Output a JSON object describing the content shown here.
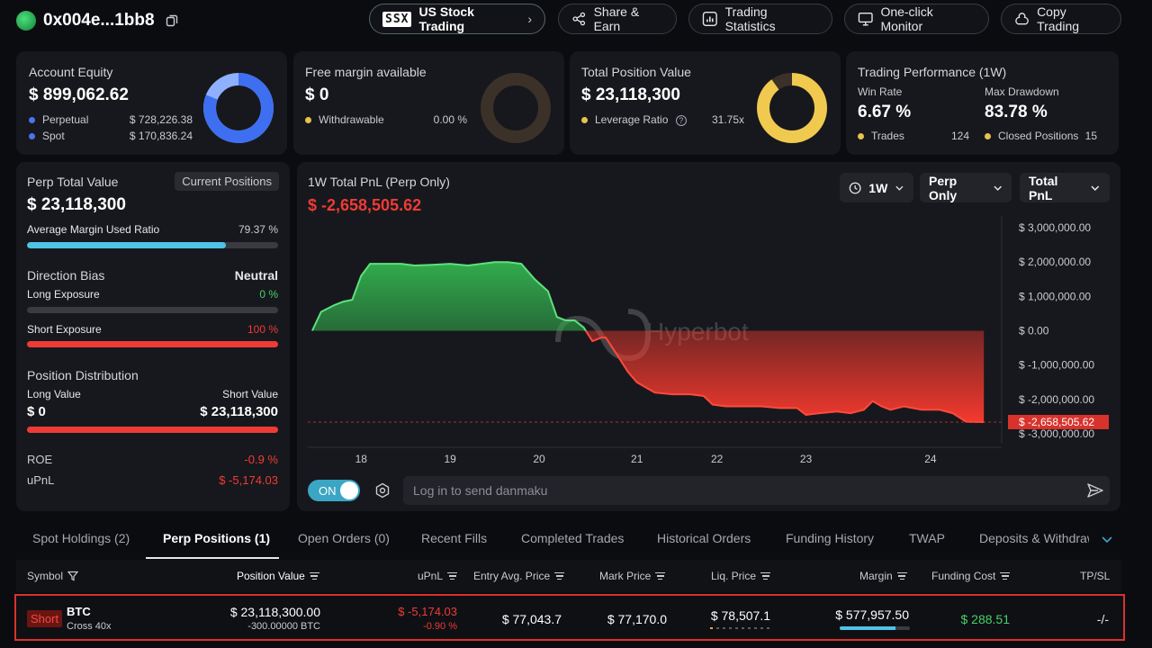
{
  "header": {
    "address": "0x004e...1bb8",
    "nav": [
      "US Stock Trading",
      "Share & Earn",
      "Trading Statistics",
      "One-click Monitor",
      "Copy Trading"
    ],
    "us_stock_logo": "SSX"
  },
  "equity": {
    "title": "Account Equity",
    "value": "$ 899,062.62",
    "rows": [
      {
        "label": "Perpetual",
        "value": "$ 728,226.38"
      },
      {
        "label": "Spot",
        "value": "$ 170,836.24"
      }
    ],
    "perp_share": 0.81,
    "color_perp": "#3e6ff0",
    "color_spot": "#8fb0ff"
  },
  "margin": {
    "title": "Free margin available",
    "value": "$ 0",
    "row_label": "Withdrawable",
    "row_value": "0.00 %"
  },
  "position_value": {
    "title": "Total Position Value",
    "value": "$ 23,118,300",
    "row_label": "Leverage Ratio",
    "row_value": "31.75x",
    "gauge_fill": 0.9
  },
  "performance": {
    "title": "Trading Performance (1W)",
    "win_rate_label": "Win Rate",
    "win_rate": "6.67 %",
    "drawdown_label": "Max Drawdown",
    "drawdown": "83.78 %",
    "trades_label": "Trades",
    "trades": "124",
    "closed_label": "Closed Positions",
    "closed": "15"
  },
  "perp_panel": {
    "title": "Perp Total Value",
    "tag": "Current Positions",
    "value": "$ 23,118,300",
    "margin_ratio_label": "Average Margin Used Ratio",
    "margin_ratio": "79.37 %",
    "margin_ratio_value": 0.7937,
    "bias_label": "Direction Bias",
    "bias": "Neutral",
    "long_exp_label": "Long Exposure",
    "long_exp": "0 %",
    "short_exp_label": "Short Exposure",
    "short_exp": "100 %",
    "dist_label": "Position Distribution",
    "long_value_label": "Long Value",
    "short_value_label": "Short Value",
    "long_value": "$ 0",
    "short_value": "$ 23,118,300",
    "roe_label": "ROE",
    "roe": "-0.9 %",
    "upnl_label": "uPnL",
    "upnl": "$ -5,174.03"
  },
  "pnl": {
    "title": "1W Total PnL (Perp Only)",
    "value": "$ -2,658,505.62",
    "dropdowns": [
      "1W",
      "Perp Only",
      "Total PnL"
    ],
    "watermark": "Hyperbot",
    "toggle": "ON",
    "danmaku_placeholder": "Log in to send danmaku"
  },
  "chart_data": {
    "type": "area",
    "y_ticks": [
      "$ 3,000,000.00",
      "$ 2,000,000.00",
      "$ 1,000,000.00",
      "$ 0.00",
      "$ -1,000,000.00",
      "$ -2,000,000.00",
      "$ -3,000,000.00"
    ],
    "ylim": [
      -3000000,
      3000000
    ],
    "x_ticks": [
      {
        "label": "18",
        "x": 18.0
      },
      {
        "label": "19",
        "x": 19.0
      },
      {
        "label": "20",
        "x": 20.0
      },
      {
        "label": "21",
        "x": 21.1
      },
      {
        "label": "22",
        "x": 22.0
      },
      {
        "label": "23",
        "x": 23.0
      },
      {
        "label": "24",
        "x": 24.4
      }
    ],
    "xlim": [
      17.4,
      25.2
    ],
    "current_label": "$ -2,658,505.62",
    "current_value": -2658505.62,
    "points": [
      [
        17.45,
        0.0
      ],
      [
        17.55,
        550000
      ],
      [
        17.7,
        750000
      ],
      [
        17.8,
        850000
      ],
      [
        17.9,
        900000
      ],
      [
        18.0,
        1600000
      ],
      [
        18.1,
        1950000
      ],
      [
        18.25,
        1950000
      ],
      [
        18.45,
        1950000
      ],
      [
        18.6,
        1900000
      ],
      [
        18.8,
        1920000
      ],
      [
        19.0,
        1950000
      ],
      [
        19.2,
        1900000
      ],
      [
        19.35,
        1950000
      ],
      [
        19.5,
        2000000
      ],
      [
        19.65,
        2000000
      ],
      [
        19.8,
        1950000
      ],
      [
        19.95,
        1500000
      ],
      [
        20.1,
        1150000
      ],
      [
        20.2,
        400000
      ],
      [
        20.3,
        300000
      ],
      [
        20.4,
        300000
      ],
      [
        20.5,
        100000
      ],
      [
        20.6,
        -300000
      ],
      [
        20.7,
        -200000
      ],
      [
        20.75,
        -200000
      ],
      [
        20.9,
        -800000
      ],
      [
        21.0,
        -1200000
      ],
      [
        21.1,
        -1500000
      ],
      [
        21.3,
        -1800000
      ],
      [
        21.5,
        -1850000
      ],
      [
        21.7,
        -1850000
      ],
      [
        21.85,
        -1900000
      ],
      [
        21.95,
        -2150000
      ],
      [
        22.1,
        -2200000
      ],
      [
        22.3,
        -2200000
      ],
      [
        22.5,
        -2200000
      ],
      [
        22.7,
        -2250000
      ],
      [
        22.9,
        -2250000
      ],
      [
        23.0,
        -2450000
      ],
      [
        23.15,
        -2400000
      ],
      [
        23.35,
        -2350000
      ],
      [
        23.5,
        -2400000
      ],
      [
        23.65,
        -2300000
      ],
      [
        23.75,
        -2050000
      ],
      [
        23.85,
        -2200000
      ],
      [
        23.95,
        -2300000
      ],
      [
        24.1,
        -2200000
      ],
      [
        24.3,
        -2300000
      ],
      [
        24.5,
        -2300000
      ],
      [
        24.65,
        -2400000
      ],
      [
        24.8,
        -2650000
      ],
      [
        25.0,
        -2658505.62
      ]
    ]
  },
  "tabs": [
    "Spot Holdings (2)",
    "Perp Positions (1)",
    "Open Orders (0)",
    "Recent Fills",
    "Completed Trades",
    "Historical Orders",
    "Funding History",
    "TWAP",
    "Deposits & Withdraw"
  ],
  "table": {
    "headers": [
      "Symbol",
      "Position Value",
      "uPnL",
      "Entry Avg. Price",
      "Mark Price",
      "Liq. Price",
      "Margin",
      "Funding Cost",
      "TP/SL"
    ],
    "row": {
      "side": "Short",
      "symbol": "BTC",
      "mode": "Cross 40x",
      "position_value": "$ 23,118,300.00",
      "size": "-300.00000 BTC",
      "upnl": "$ -5,174.03",
      "upnl_pct": "-0.90 %",
      "entry": "$ 77,043.7",
      "mark": "$ 77,170.0",
      "liq": "$ 78,507.1",
      "margin": "$ 577,957.50",
      "margin_fill": 0.8,
      "funding": "$ 288.51",
      "tpsl": "-/-"
    }
  }
}
